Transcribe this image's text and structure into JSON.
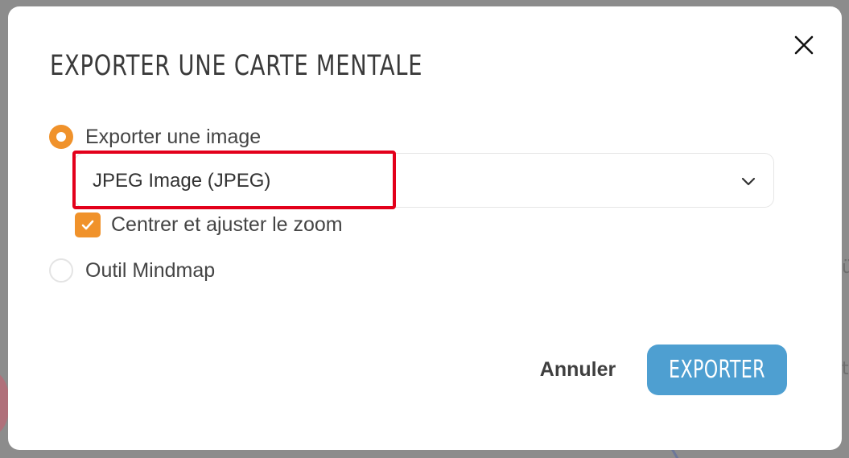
{
  "dialog": {
    "title": "EXPORTER UNE CARTE MENTALE",
    "close_icon": "close-icon"
  },
  "options": [
    {
      "id": "image",
      "label": "Exporter une image",
      "selected": true
    },
    {
      "id": "mindmap",
      "label": "Outil Mindmap",
      "selected": false
    }
  ],
  "format_select": {
    "value": "JPEG Image (JPEG)",
    "icon": "chevron-down-icon"
  },
  "zoom_checkbox": {
    "label": "Centrer et ajuster le zoom",
    "checked": true
  },
  "actions": {
    "cancel_label": "Annuler",
    "export_label": "EXPORTER"
  },
  "colors": {
    "accent_orange": "#f0922b",
    "primary_blue": "#4e9fd1",
    "highlight_red": "#e3001b"
  }
}
